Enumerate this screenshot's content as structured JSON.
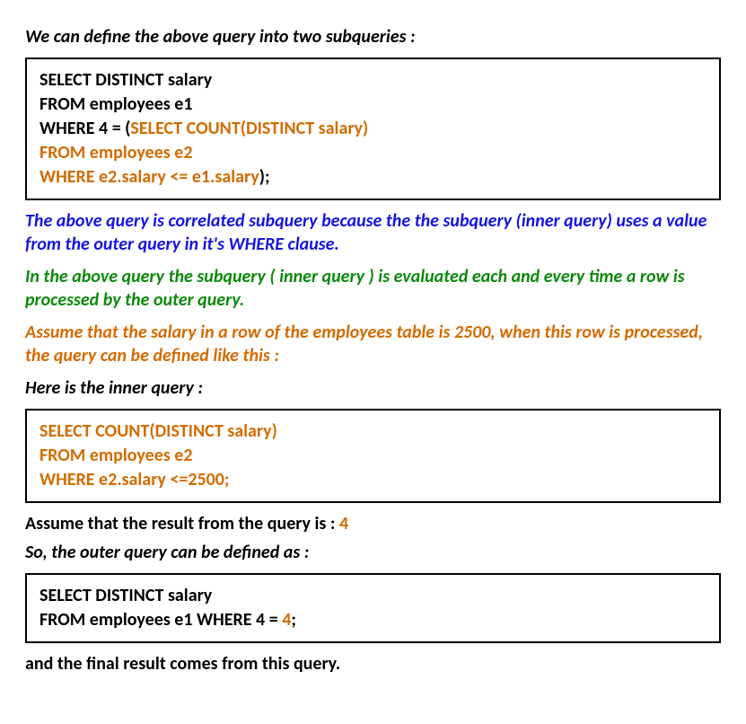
{
  "intro": "We can define the above query into two subqueries :",
  "query1": {
    "l1": "SELECT DISTINCT salary",
    "l2": "FROM employees e1",
    "l3a": "WHERE 4 = (",
    "l3b": "SELECT COUNT(DISTINCT salary)",
    "l4": "FROM employees  e2",
    "l5": "WHERE e2.salary <= e1.salary",
    "l5b": ");"
  },
  "note_blue": "The above query is correlated subquery because the the subquery (inner query) uses a value from the outer query in it's WHERE clause.",
  "note_green": "In the above query the subquery ( inner query ) is evaluated each and every time a row is processed by the outer query.",
  "note_orange1": "Assume that the salary in a row of the employees table is 2500, when this row is processed, the query can be defined  like this :",
  "here_inner": "Here is the inner query :",
  "query2": {
    "l1": "SELECT COUNT(DISTINCT salary)",
    "l2": "FROM employees  e2",
    "l3": "WHERE e2.salary <=2500;"
  },
  "assume_result_a": "Assume that the result from the query is : ",
  "assume_result_b": "4",
  "outer_defined": "So, the outer query can be defined as :",
  "query3": {
    "l1": "SELECT DISTINCT salary",
    "l2a": "FROM employees e1 WHERE 4 = ",
    "l2b": "4",
    "l2c": ";"
  },
  "final": "and the final result comes from this query."
}
